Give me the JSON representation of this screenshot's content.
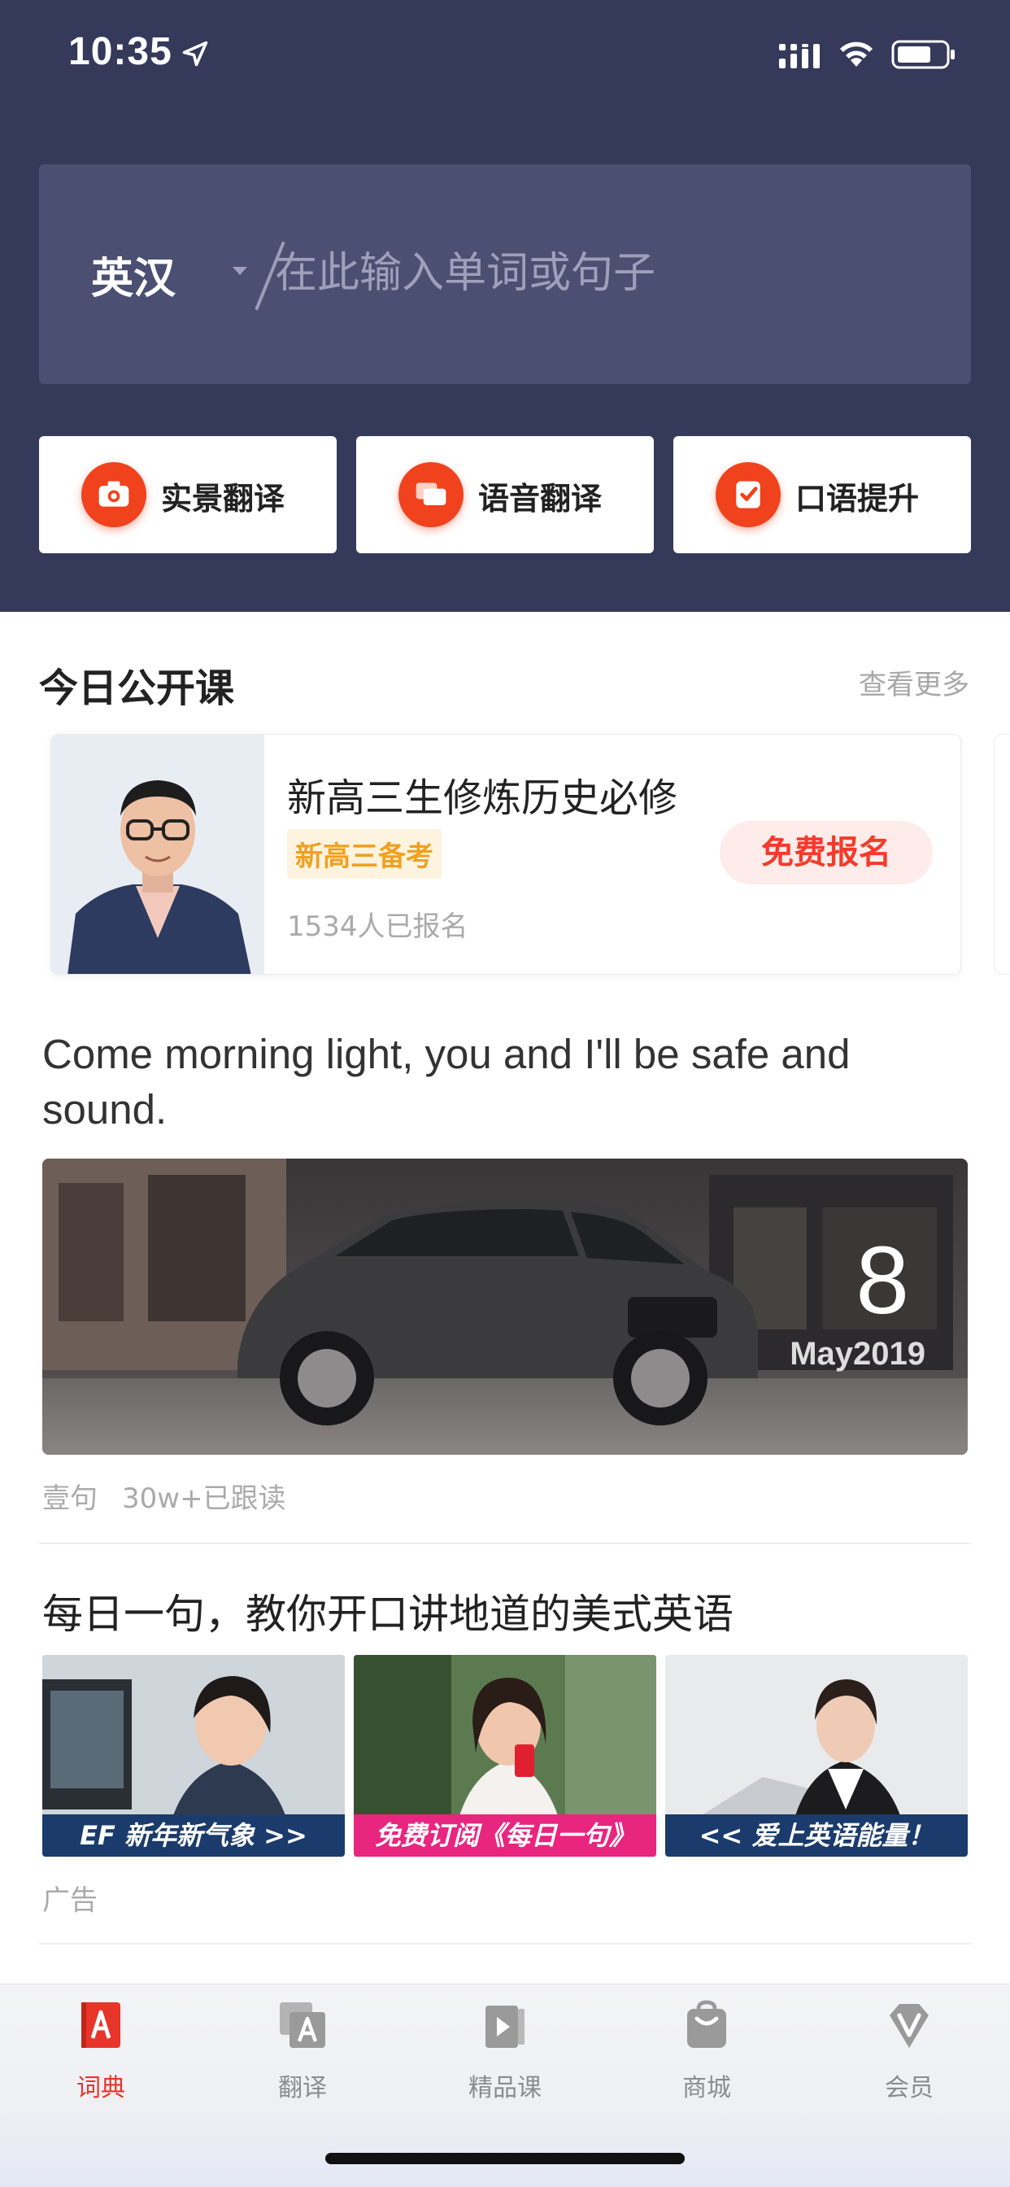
{
  "status_bar": {
    "time": "10:35"
  },
  "search": {
    "lang_label": "英汉",
    "placeholder": "在此输入单词或句子"
  },
  "features": [
    {
      "label": "实景翻译",
      "icon": "camera-icon"
    },
    {
      "label": "语音翻译",
      "icon": "chat-icon"
    },
    {
      "label": "口语提升",
      "icon": "speaking-icon"
    }
  ],
  "open_class": {
    "title": "今日公开课",
    "see_more": "查看更多",
    "course": {
      "title": "新高三生修炼历史必修",
      "tag": "新高三备考",
      "count": "1534人已报名",
      "signup": "免费报名"
    }
  },
  "daily_sentence": {
    "quote": "Come morning light, you and I'll be safe and sound.",
    "date_day": "8",
    "date_month": "May2019",
    "source": "壹句",
    "readers": "30w+已跟读"
  },
  "ad": {
    "title": "每日一句，教你开口讲地道的美式英语",
    "tiles": [
      {
        "caption": "EF  新年新气象 >>",
        "color": "#1a3b6b"
      },
      {
        "caption": "免费订阅《每日一句》",
        "color": "#e8257f"
      },
      {
        "caption": "<<  爱上英语能量！",
        "color": "#1a3b6b"
      }
    ],
    "label": "广告"
  },
  "tabs": [
    {
      "label": "词典",
      "icon": "dictionary-icon",
      "active": true
    },
    {
      "label": "翻译",
      "icon": "translate-icon",
      "active": false
    },
    {
      "label": "精品课",
      "icon": "course-icon",
      "active": false
    },
    {
      "label": "商城",
      "icon": "shop-icon",
      "active": false
    },
    {
      "label": "会员",
      "icon": "vip-icon",
      "active": false
    }
  ],
  "colors": {
    "header": "#35395a",
    "accent": "#f0421d",
    "active_tab": "#e8352a"
  }
}
